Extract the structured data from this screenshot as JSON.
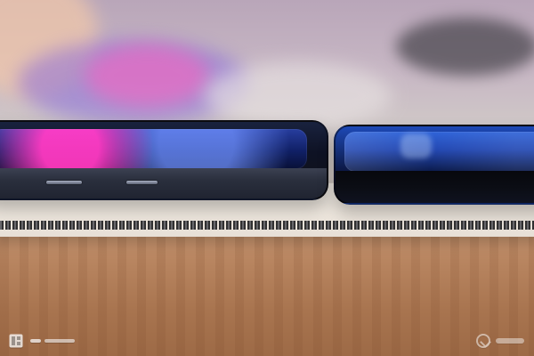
{
  "scene": {
    "subject": "two-phones-on-notebook",
    "colors": {
      "desk": "#b98661",
      "background_top": "#c7b7c4",
      "pad": "#efe8df",
      "phone_left_body": "#111218",
      "phone_right_body": "#0d1a49",
      "phone_right_screen": "#2f63d8",
      "pink_bokeh": "#ff5fbf"
    }
  },
  "icons": {
    "left_watermark": "watermark-logo-icon",
    "right_watermark": "watermark-check-icon"
  }
}
